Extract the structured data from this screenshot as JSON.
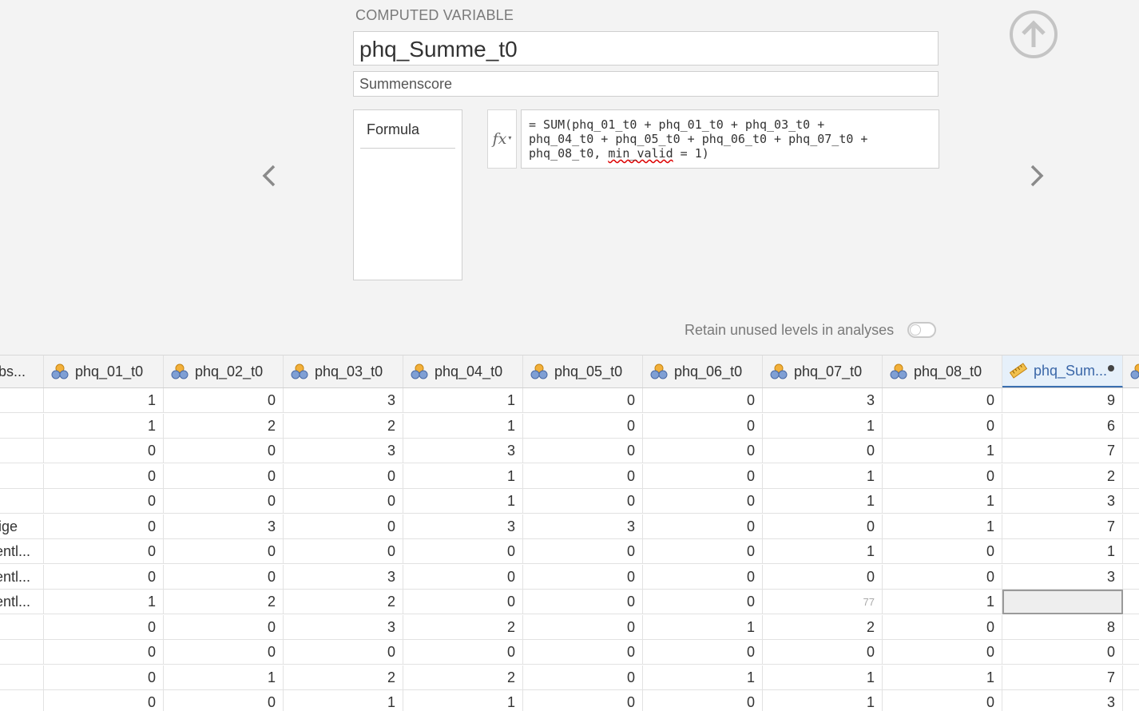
{
  "setup": {
    "header": "COMPUTED VARIABLE",
    "name": "phq_Summe_t0",
    "description": "Summenscore",
    "formula_tab": "Formula",
    "fx_label": "fx",
    "formula_part1": "= SUM(phq_01_t0 + phq_01_t0 + phq_03_t0 +\nphq_04_t0 + phq_05_t0 + phq_06_t0 + phq_07_t0 +\nphq_08_t0, ",
    "formula_flagged": "min_valid",
    "formula_part2": " = 1)",
    "retain_label": "Retain unused levels in analyses",
    "retain_on": false
  },
  "columns": [
    "lbs...",
    "phq_01_t0",
    "phq_02_t0",
    "phq_03_t0",
    "phq_04_t0",
    "phq_05_t0",
    "phq_06_t0",
    "phq_07_t0",
    "phq_08_t0",
    "phq_Sum..."
  ],
  "rows": [
    [
      "",
      "1",
      "0",
      "3",
      "1",
      "0",
      "0",
      "3",
      "0",
      "9"
    ],
    [
      "",
      "1",
      "2",
      "2",
      "1",
      "0",
      "0",
      "1",
      "0",
      "6"
    ],
    [
      "",
      "0",
      "0",
      "3",
      "3",
      "0",
      "0",
      "0",
      "1",
      "7"
    ],
    [
      "",
      "0",
      "0",
      "0",
      "1",
      "0",
      "0",
      "1",
      "0",
      "2"
    ],
    [
      "",
      "0",
      "0",
      "0",
      "1",
      "0",
      "0",
      "1",
      "1",
      "3"
    ],
    [
      "lige",
      "0",
      "3",
      "0",
      "3",
      "3",
      "0",
      "0",
      "1",
      "7"
    ],
    [
      "entl...",
      "0",
      "0",
      "0",
      "0",
      "0",
      "0",
      "1",
      "0",
      "1"
    ],
    [
      "entl...",
      "0",
      "0",
      "3",
      "0",
      "0",
      "0",
      "0",
      "0",
      "3"
    ],
    [
      "entl...",
      "1",
      "2",
      "2",
      "0",
      "0",
      "0",
      "77",
      "1",
      ""
    ],
    [
      "",
      "0",
      "0",
      "3",
      "2",
      "0",
      "1",
      "2",
      "0",
      "8"
    ],
    [
      "",
      "0",
      "0",
      "0",
      "0",
      "0",
      "0",
      "0",
      "0",
      "0"
    ],
    [
      "",
      "0",
      "1",
      "2",
      "2",
      "0",
      "1",
      "1",
      "1",
      "7"
    ],
    [
      "",
      "0",
      "0",
      "1",
      "1",
      "0",
      "0",
      "1",
      "0",
      "3"
    ]
  ],
  "icons": {
    "nominal": "nominal-variable-icon",
    "continuous": "continuous-ruler-icon",
    "up": "arrow-up-circle-icon",
    "prev": "chevron-left-icon",
    "next": "chevron-right-icon"
  }
}
